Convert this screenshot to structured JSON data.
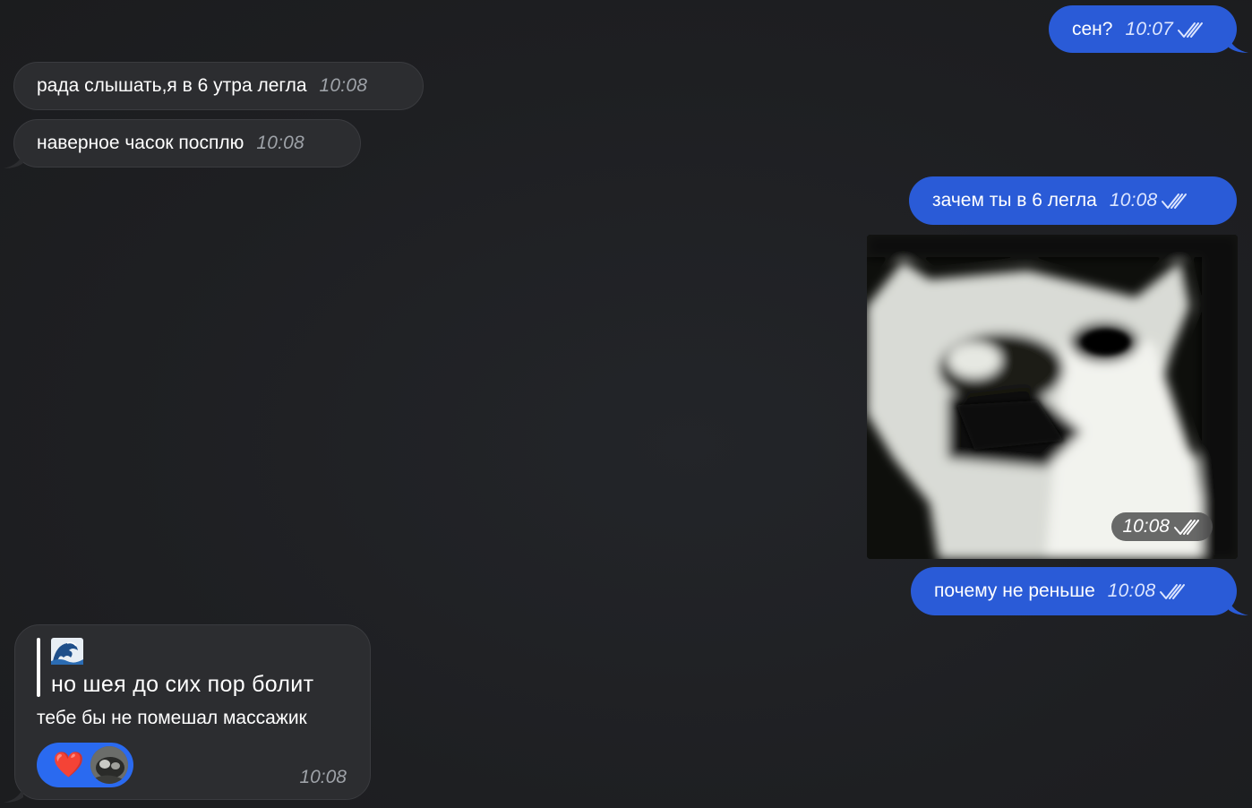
{
  "messages": {
    "m1": {
      "text": "сен?",
      "time": "10:07"
    },
    "m2": {
      "text": "рада слышать,я в 6 утра легла",
      "time": "10:08"
    },
    "m3": {
      "text": "наверное часок посплю",
      "time": "10:08"
    },
    "m4": {
      "text": "зачем ты в 6 легла",
      "time": "10:08"
    },
    "m5": {
      "time": "10:08"
    },
    "m6": {
      "text": "почему не реньше",
      "time": "10:08"
    },
    "m7": {
      "quote": "но шея до сих пор болит",
      "text": "тебе бы не помешал массажик",
      "time": "10:08",
      "reaction": "❤️"
    }
  },
  "colors": {
    "background": "#1f2023",
    "incoming_bubble": "#2c2d30",
    "outgoing_bubble": "#2a5bd7",
    "reaction_pill": "#2a6af0"
  },
  "icons": {
    "read_receipt": "double-check-icon",
    "quote_emoji": "wave-emoji-icon",
    "reaction_heart": "heart-icon"
  }
}
